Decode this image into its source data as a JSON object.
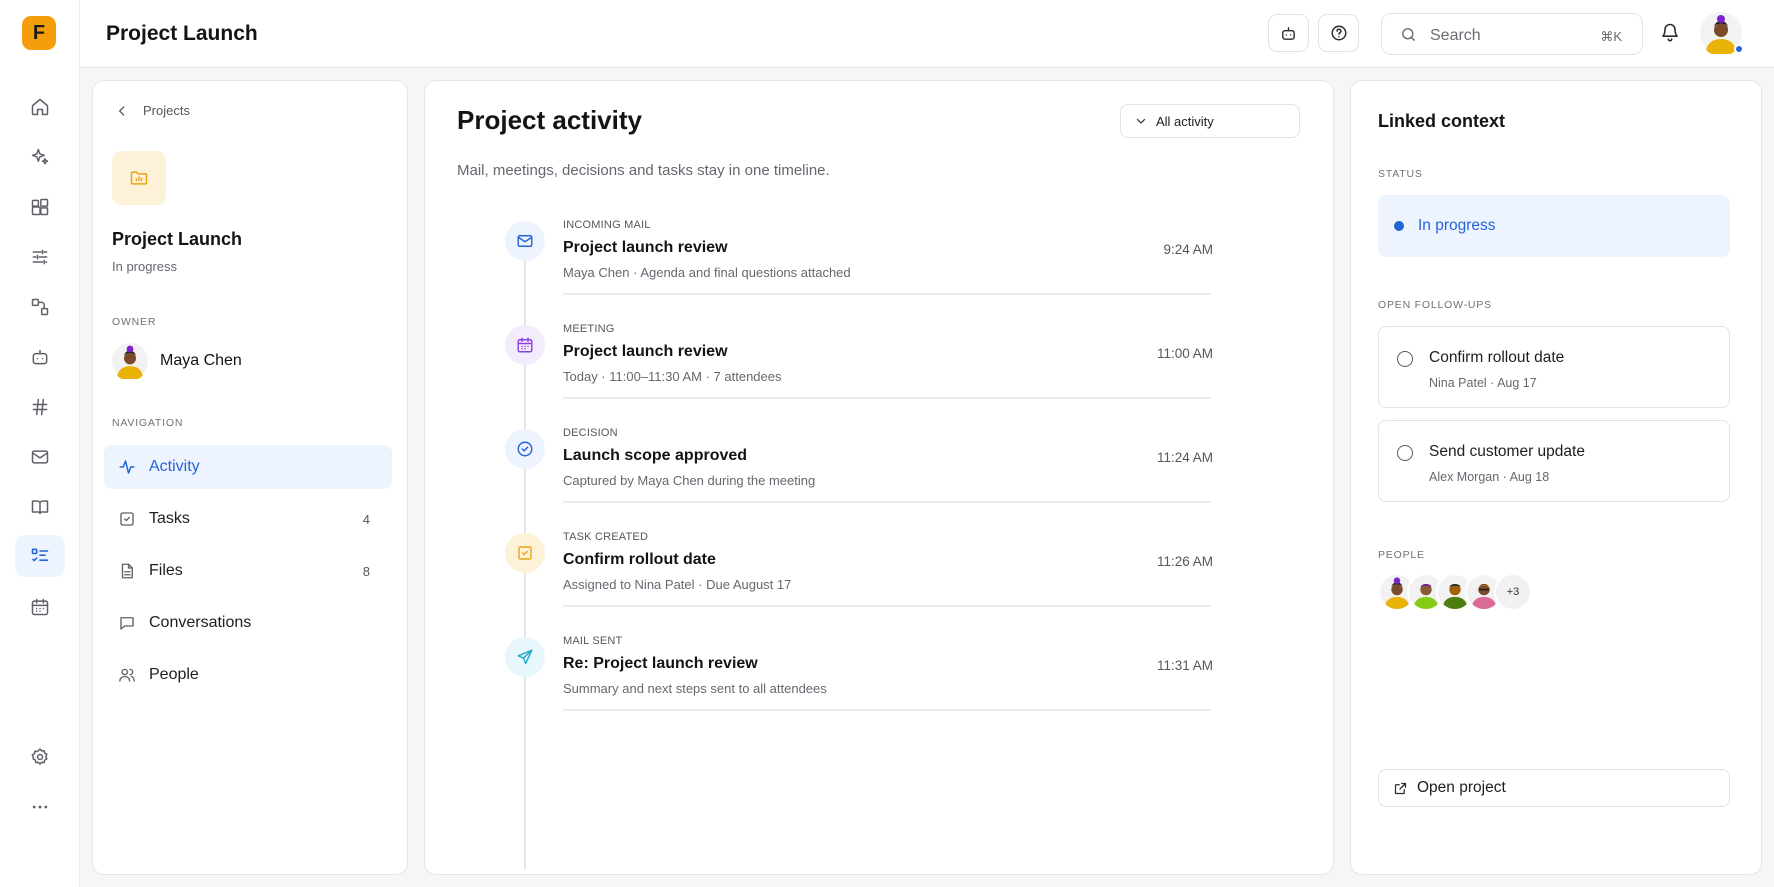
{
  "app": {
    "logo_letter": "F",
    "title": "Project Launch"
  },
  "rail": [
    {
      "icon": "home-icon"
    },
    {
      "icon": "sparkle-icon"
    },
    {
      "icon": "grid-plus-icon"
    },
    {
      "icon": "sliders-icon"
    },
    {
      "icon": "workflow-icon"
    },
    {
      "icon": "bot-icon"
    },
    {
      "icon": "hash-icon"
    },
    {
      "icon": "mail-icon"
    },
    {
      "icon": "book-icon"
    },
    {
      "icon": "tasks-list-icon",
      "active": true
    },
    {
      "icon": "calendar-icon"
    },
    {
      "icon": "settings-icon"
    },
    {
      "icon": "more-icon"
    }
  ],
  "topbar": {
    "search_placeholder": "Search",
    "search_shortcut": "⌘K"
  },
  "left": {
    "back_label": "Projects",
    "project_name": "Project Launch",
    "project_status": "In progress",
    "owner_heading": "OWNER",
    "owner_name": "Maya Chen",
    "nav_heading": "NAVIGATION",
    "nav": [
      {
        "label": "Activity",
        "icon": "activity-icon",
        "count": "",
        "active": true
      },
      {
        "label": "Tasks",
        "icon": "checkbox-icon",
        "count": "4"
      },
      {
        "label": "Files",
        "icon": "file-icon",
        "count": "8"
      },
      {
        "label": "Conversations",
        "icon": "chat-icon",
        "count": ""
      },
      {
        "label": "People",
        "icon": "people-icon",
        "count": ""
      }
    ]
  },
  "center": {
    "title": "Project activity",
    "filter_label": "All activity",
    "subtitle": "Mail, meetings, decisions and tasks stay in one timeline.",
    "items": [
      {
        "kind": "INCOMING MAIL",
        "title": "Project launch review",
        "time": "9:24 AM",
        "meta": "Maya Chen · Agenda and final questions attached",
        "icon": "mail-icon",
        "color": "#2563d8",
        "bg": "#eef4fd"
      },
      {
        "kind": "MEETING",
        "title": "Project launch review",
        "time": "11:00 AM",
        "meta": "Today · 11:00–11:30 AM · 7 attendees",
        "icon": "calendar-icon",
        "color": "#8b3fd9",
        "bg": "#f3ecfd"
      },
      {
        "kind": "DECISION",
        "title": "Launch scope approved",
        "time": "11:24 AM",
        "meta": "Captured by Maya Chen during the meeting",
        "icon": "check-circle-icon",
        "color": "#2563d8",
        "bg": "#eef4fd"
      },
      {
        "kind": "TASK CREATED",
        "title": "Confirm rollout date",
        "time": "11:26 AM",
        "meta": "Assigned to Nina Patel · Due August 17",
        "icon": "task-check-icon",
        "color": "#e8a516",
        "bg": "#fdf1d7"
      },
      {
        "kind": "MAIL SENT",
        "title": "Re: Project launch review",
        "time": "11:31 AM",
        "meta": "Summary and next steps sent to all attendees",
        "icon": "send-icon",
        "color": "#1fa6c9",
        "bg": "#e8f7fb"
      }
    ]
  },
  "right": {
    "title": "Linked context",
    "status_heading": "STATUS",
    "status_value": "In progress",
    "followups_heading": "OPEN FOLLOW-UPS",
    "followups": [
      {
        "title": "Confirm rollout date",
        "meta": "Nina Patel · Aug 17"
      },
      {
        "title": "Send customer update",
        "meta": "Alex Morgan · Aug 18"
      }
    ],
    "people_heading": "PEOPLE",
    "people_more": "+3",
    "open_label": "Open project"
  },
  "colors": {
    "accent": "#2563d8",
    "logo": "#f59e0b"
  }
}
